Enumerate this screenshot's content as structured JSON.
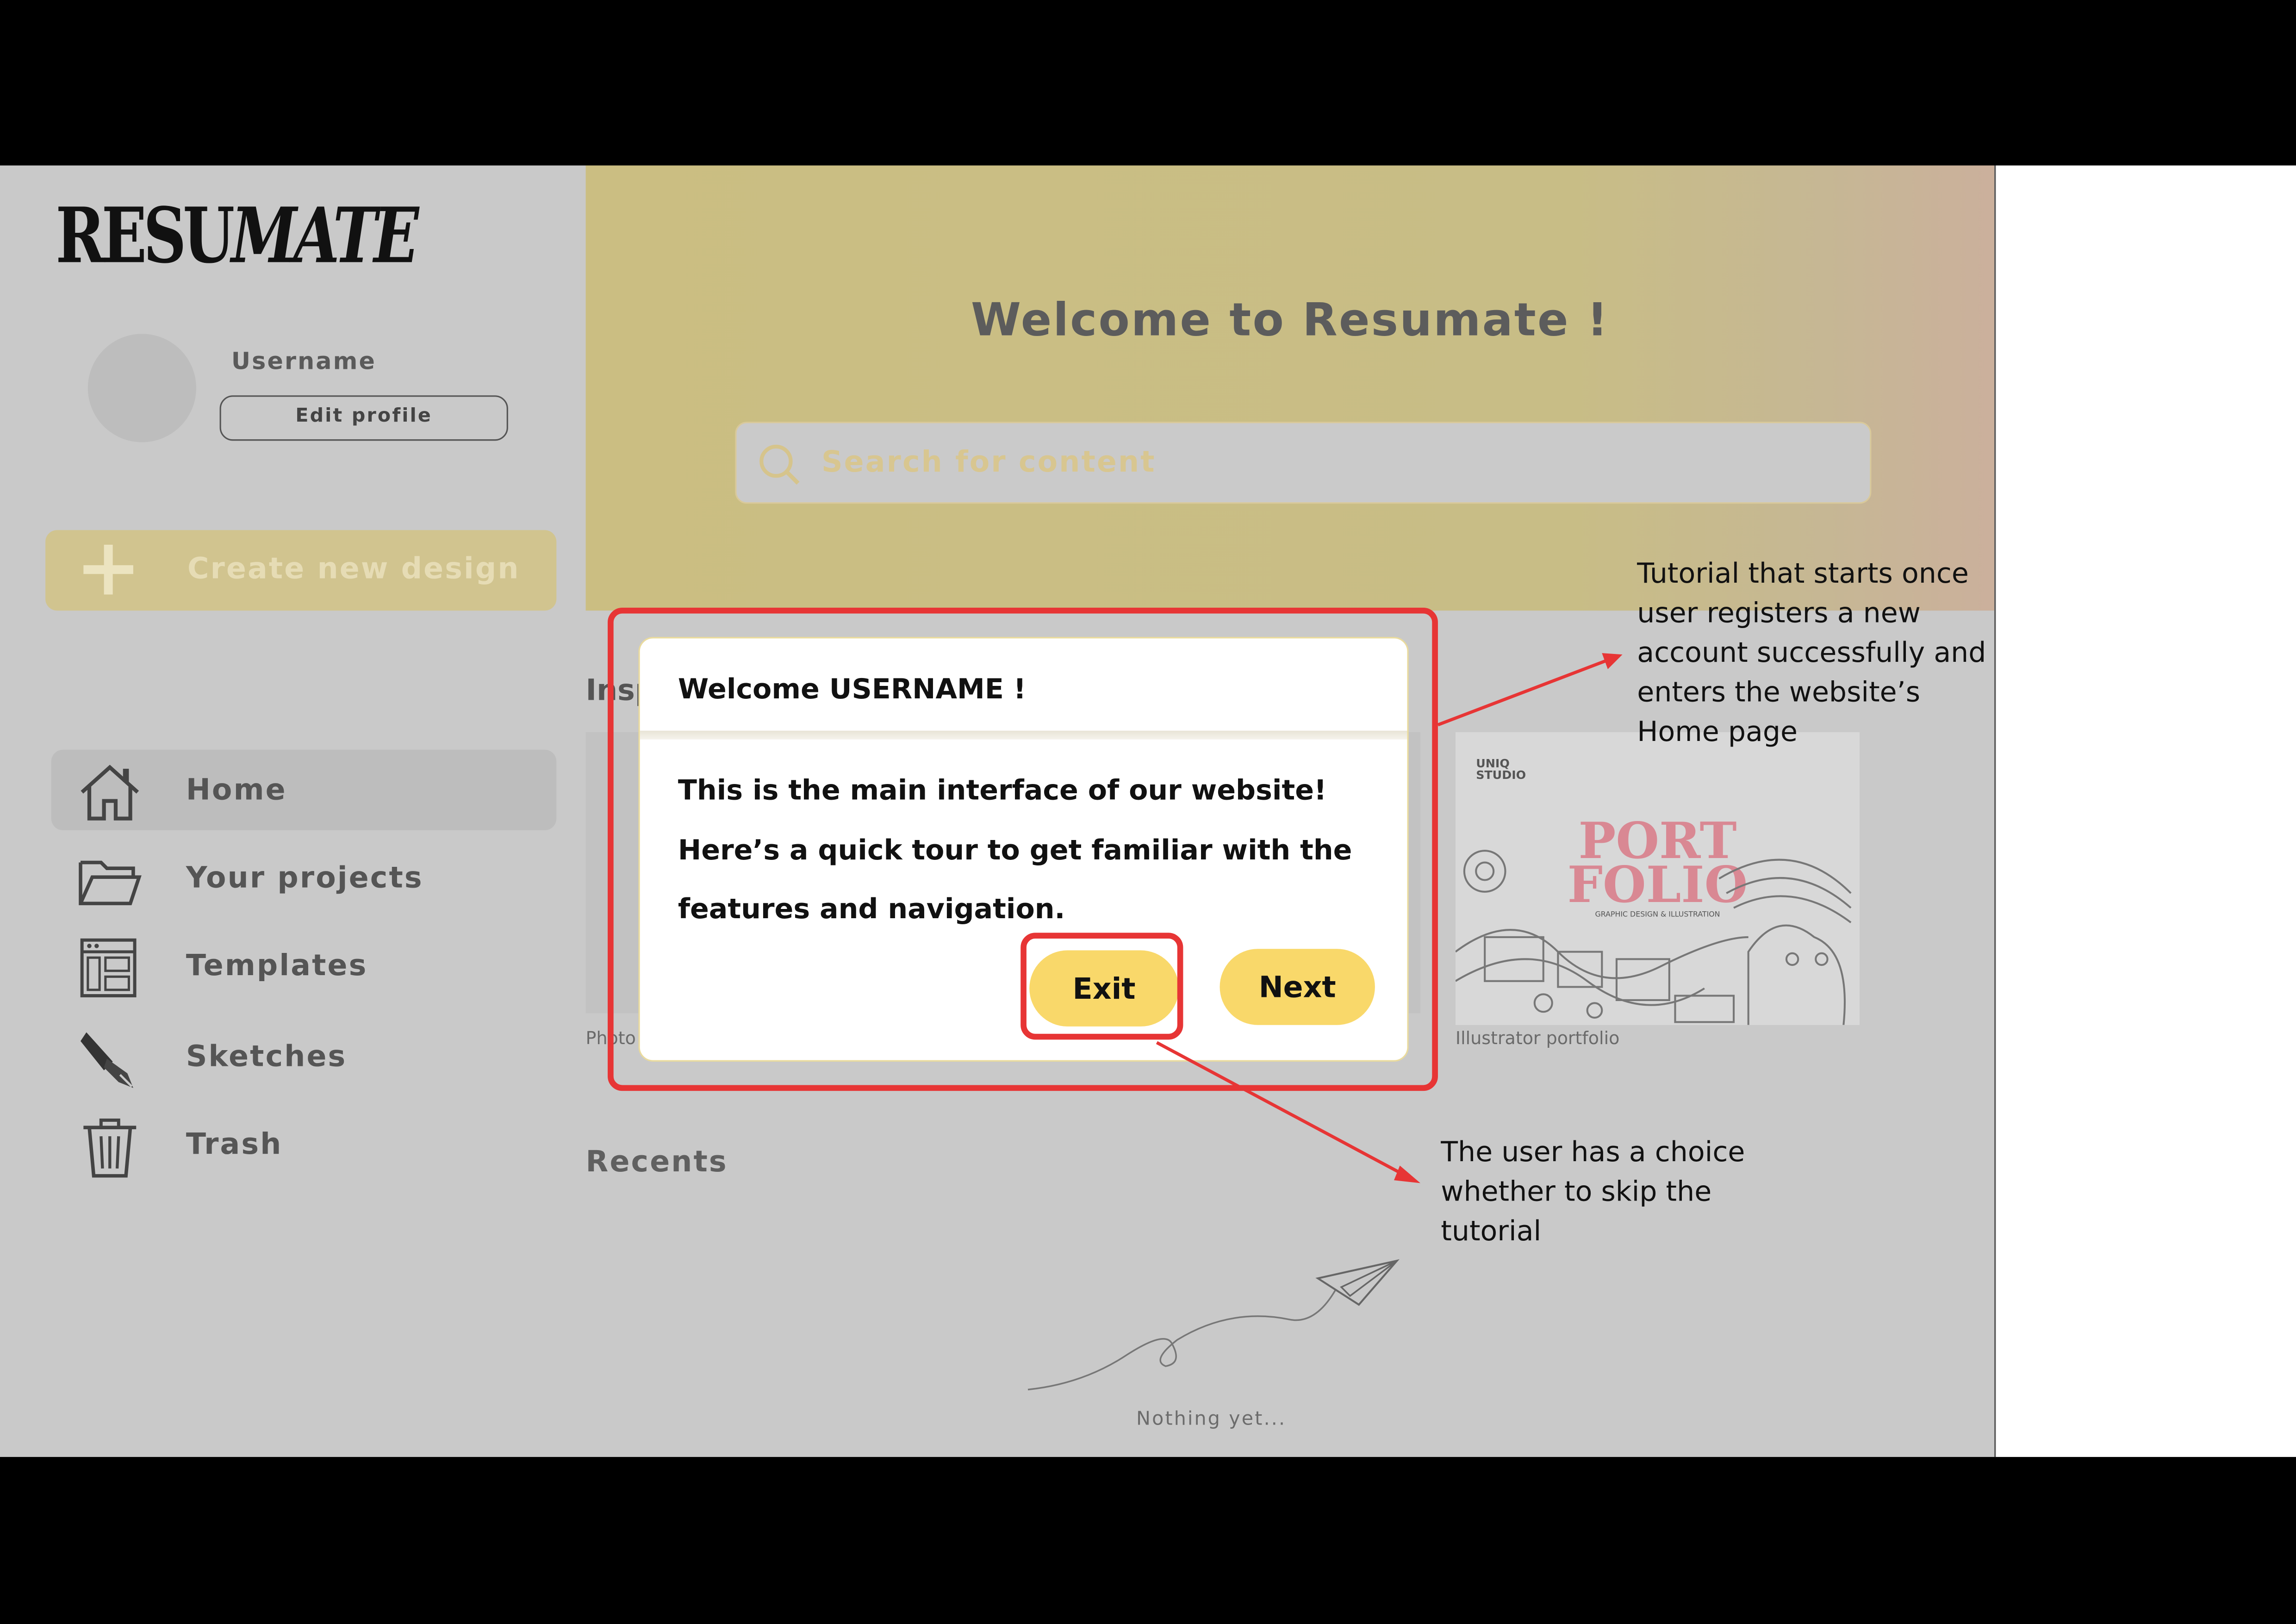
{
  "app": {
    "logo": {
      "prefix": "RESU",
      "suffix": "MATE"
    },
    "user": {
      "username": "Username",
      "edit_label": "Edit profile"
    },
    "create_label": "Create new design",
    "nav": [
      {
        "label": "Home",
        "icon": "home-icon",
        "active": true
      },
      {
        "label": "Your projects",
        "icon": "folder-icon",
        "active": false
      },
      {
        "label": "Templates",
        "icon": "templates-icon",
        "active": false
      },
      {
        "label": "Sketches",
        "icon": "pen-icon",
        "active": false
      },
      {
        "label": "Trash",
        "icon": "trash-icon",
        "active": false
      }
    ],
    "hero": {
      "title": "Welcome to Resumate !",
      "search_placeholder": "Search for content"
    },
    "inspiration": {
      "heading": "Insp",
      "cards": [
        {
          "caption": "Photo"
        },
        {
          "caption": "Illustrator portfolio",
          "thumb_brand": "UNIQ\nSTUDIO",
          "thumb_title": "PORT\nFOLIO",
          "thumb_subtitle": "GRAPHIC DESIGN & ILLUSTRATION"
        }
      ]
    },
    "recents": {
      "heading": "Recents",
      "empty_text": "Nothing yet..."
    }
  },
  "dialog": {
    "title": "Welcome USERNAME !",
    "body_lines": [
      "This is the main interface of our website!",
      "Here’s a quick tour to get familiar with the",
      "features and navigation."
    ],
    "exit_label": "Exit",
    "next_label": "Next"
  },
  "annotations": {
    "tutorial_note": "Tutorial that starts once user registers a new account successfully and enters the website’s Home page",
    "skip_note": "The user has a choice whether to skip the tutorial"
  },
  "colors": {
    "highlight": "#e73535",
    "button": "#f9d86a",
    "overlay_gray": "#c9c9c9",
    "brand_pink": "#e07a86"
  }
}
